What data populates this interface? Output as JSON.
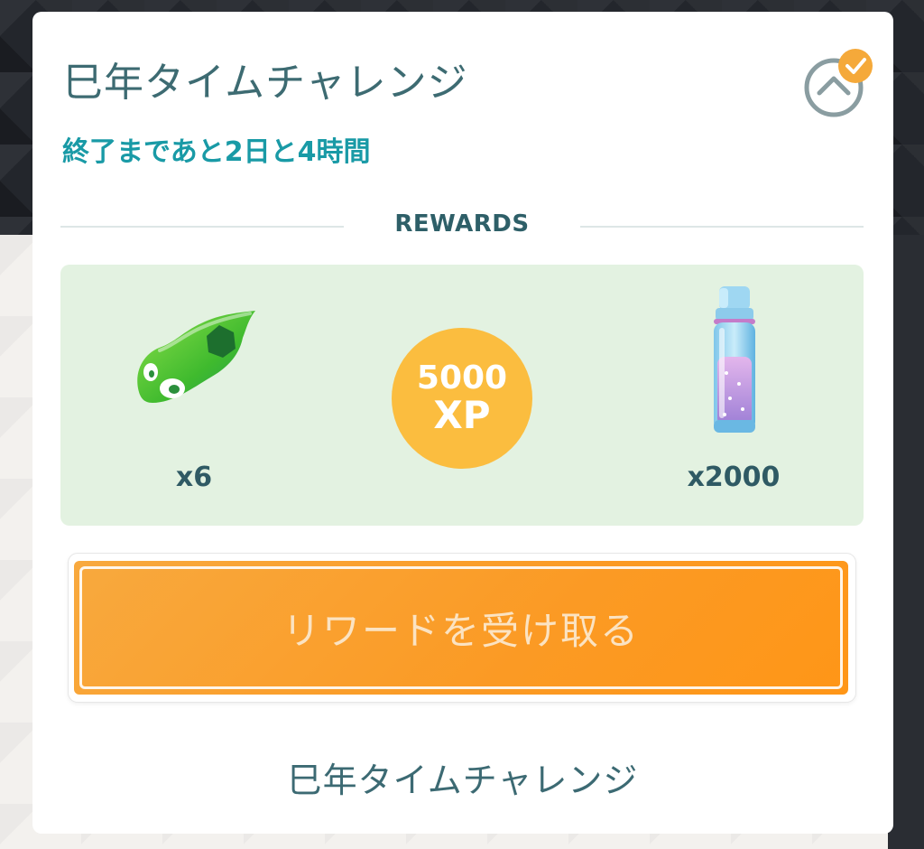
{
  "challenge": {
    "title": "巳年タイムチャレンジ",
    "time_remaining": "終了まであと2日と4時間"
  },
  "rewards": {
    "heading": "REWARDS",
    "items": [
      {
        "icon": "snake-scale-icon",
        "count": "x6"
      },
      {
        "icon": "xp-icon",
        "amount": "5000",
        "unit": "XP"
      },
      {
        "icon": "stardust-jar-icon",
        "count": "x2000"
      }
    ]
  },
  "claim_button": {
    "label": "リワードを受け取る"
  },
  "footer": {
    "title": "巳年タイムチャレンジ"
  },
  "colors": {
    "title": "#3d6b72",
    "subtitle": "#199aa6",
    "panel_bg": "#e3f2e1",
    "xp_circle": "#fbbd3f",
    "claim_button": "#fb9a24",
    "check_badge": "#f5a93a"
  }
}
